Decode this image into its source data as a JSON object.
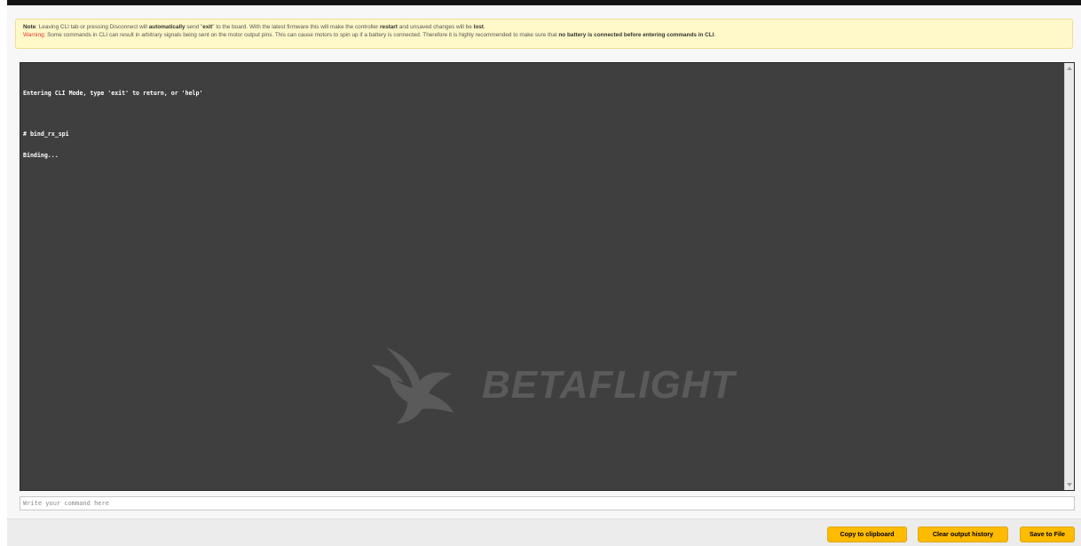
{
  "notice": {
    "note_label": "Note",
    "note_part1": ": Leaving CLI tab or pressing Disconnect will ",
    "note_bold1": "automatically",
    "note_part2": " send \"",
    "note_bold2": "exit",
    "note_part3": "\" to the board. With the latest firmware this will make the controller ",
    "note_bold3": "restart",
    "note_part4": " and unsaved changes will be ",
    "note_bold4": "lost",
    "note_part5": ".",
    "warning_label": "Warning",
    "warning_part1": ": Some commands in CLI can result in arbitrary signals being sent on the motor output pins. This can cause motors to spin up if a battery is connected. Therefore it is highly recommended to make sure that ",
    "warning_bold": "no battery is connected before entering commands in CLI",
    "warning_part2": "."
  },
  "console": {
    "lines": [
      "Entering CLI Mode, type 'exit' to return, or 'help'",
      "",
      "# bind_rx_spi",
      "Binding..."
    ],
    "watermark": "BETAFLIGHT"
  },
  "command_input": {
    "placeholder": "Write your command here",
    "value": ""
  },
  "buttons": {
    "copy": "Copy to clipboard",
    "clear": "Clear output history",
    "save": "Save to File"
  },
  "colors": {
    "accent": "#ffbb00",
    "console_bg": "#3f3f3f",
    "notice_bg": "#fff8c8",
    "warning": "#e2382e"
  }
}
